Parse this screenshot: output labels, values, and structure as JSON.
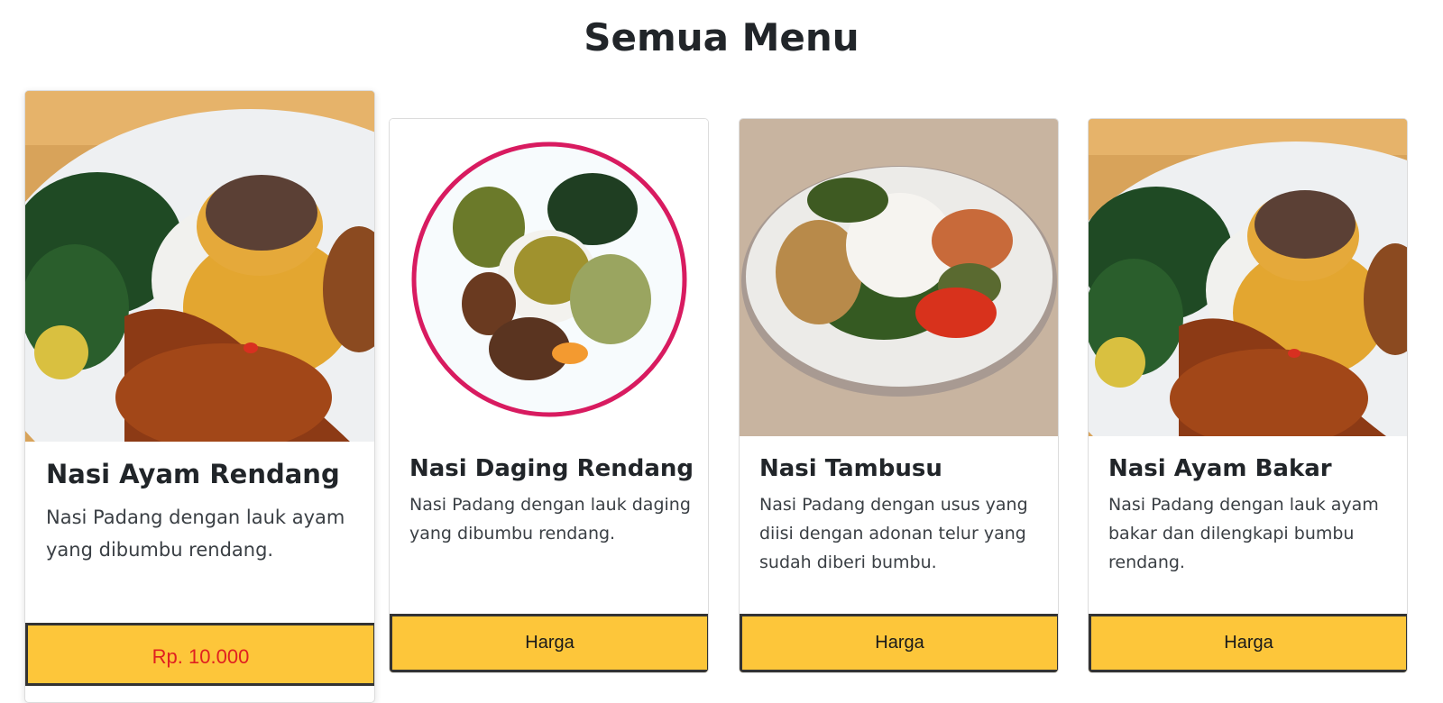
{
  "page": {
    "title": "Semua Menu"
  },
  "colors": {
    "button_bg": "#fdc63a",
    "button_border": "#333333",
    "price_text": "#e02020",
    "plate_ring": "#d81b60"
  },
  "cards": [
    {
      "title": "Nasi Ayam Rendang",
      "description": "Nasi Padang dengan lauk ayam yang dibumbu rendang.",
      "button_label": "Rp. 10.000",
      "image_icon": "food-photo-ayam-rendang-icon"
    },
    {
      "title": "Nasi Daging Rendang",
      "description": "Nasi Padang dengan lauk daging yang dibumbu rendang.",
      "button_label": "Harga",
      "image_icon": "food-photo-daging-rendang-icon"
    },
    {
      "title": "Nasi Tambusu",
      "description": "Nasi Padang dengan usus yang diisi dengan adonan telur yang sudah diberi bumbu.",
      "button_label": "Harga",
      "image_icon": "food-photo-tambusu-icon"
    },
    {
      "title": "Nasi Ayam Bakar",
      "description": "Nasi Padang dengan lauk ayam bakar dan dilengkapi bumbu rendang.",
      "button_label": "Harga",
      "image_icon": "food-photo-ayam-bakar-icon"
    }
  ]
}
